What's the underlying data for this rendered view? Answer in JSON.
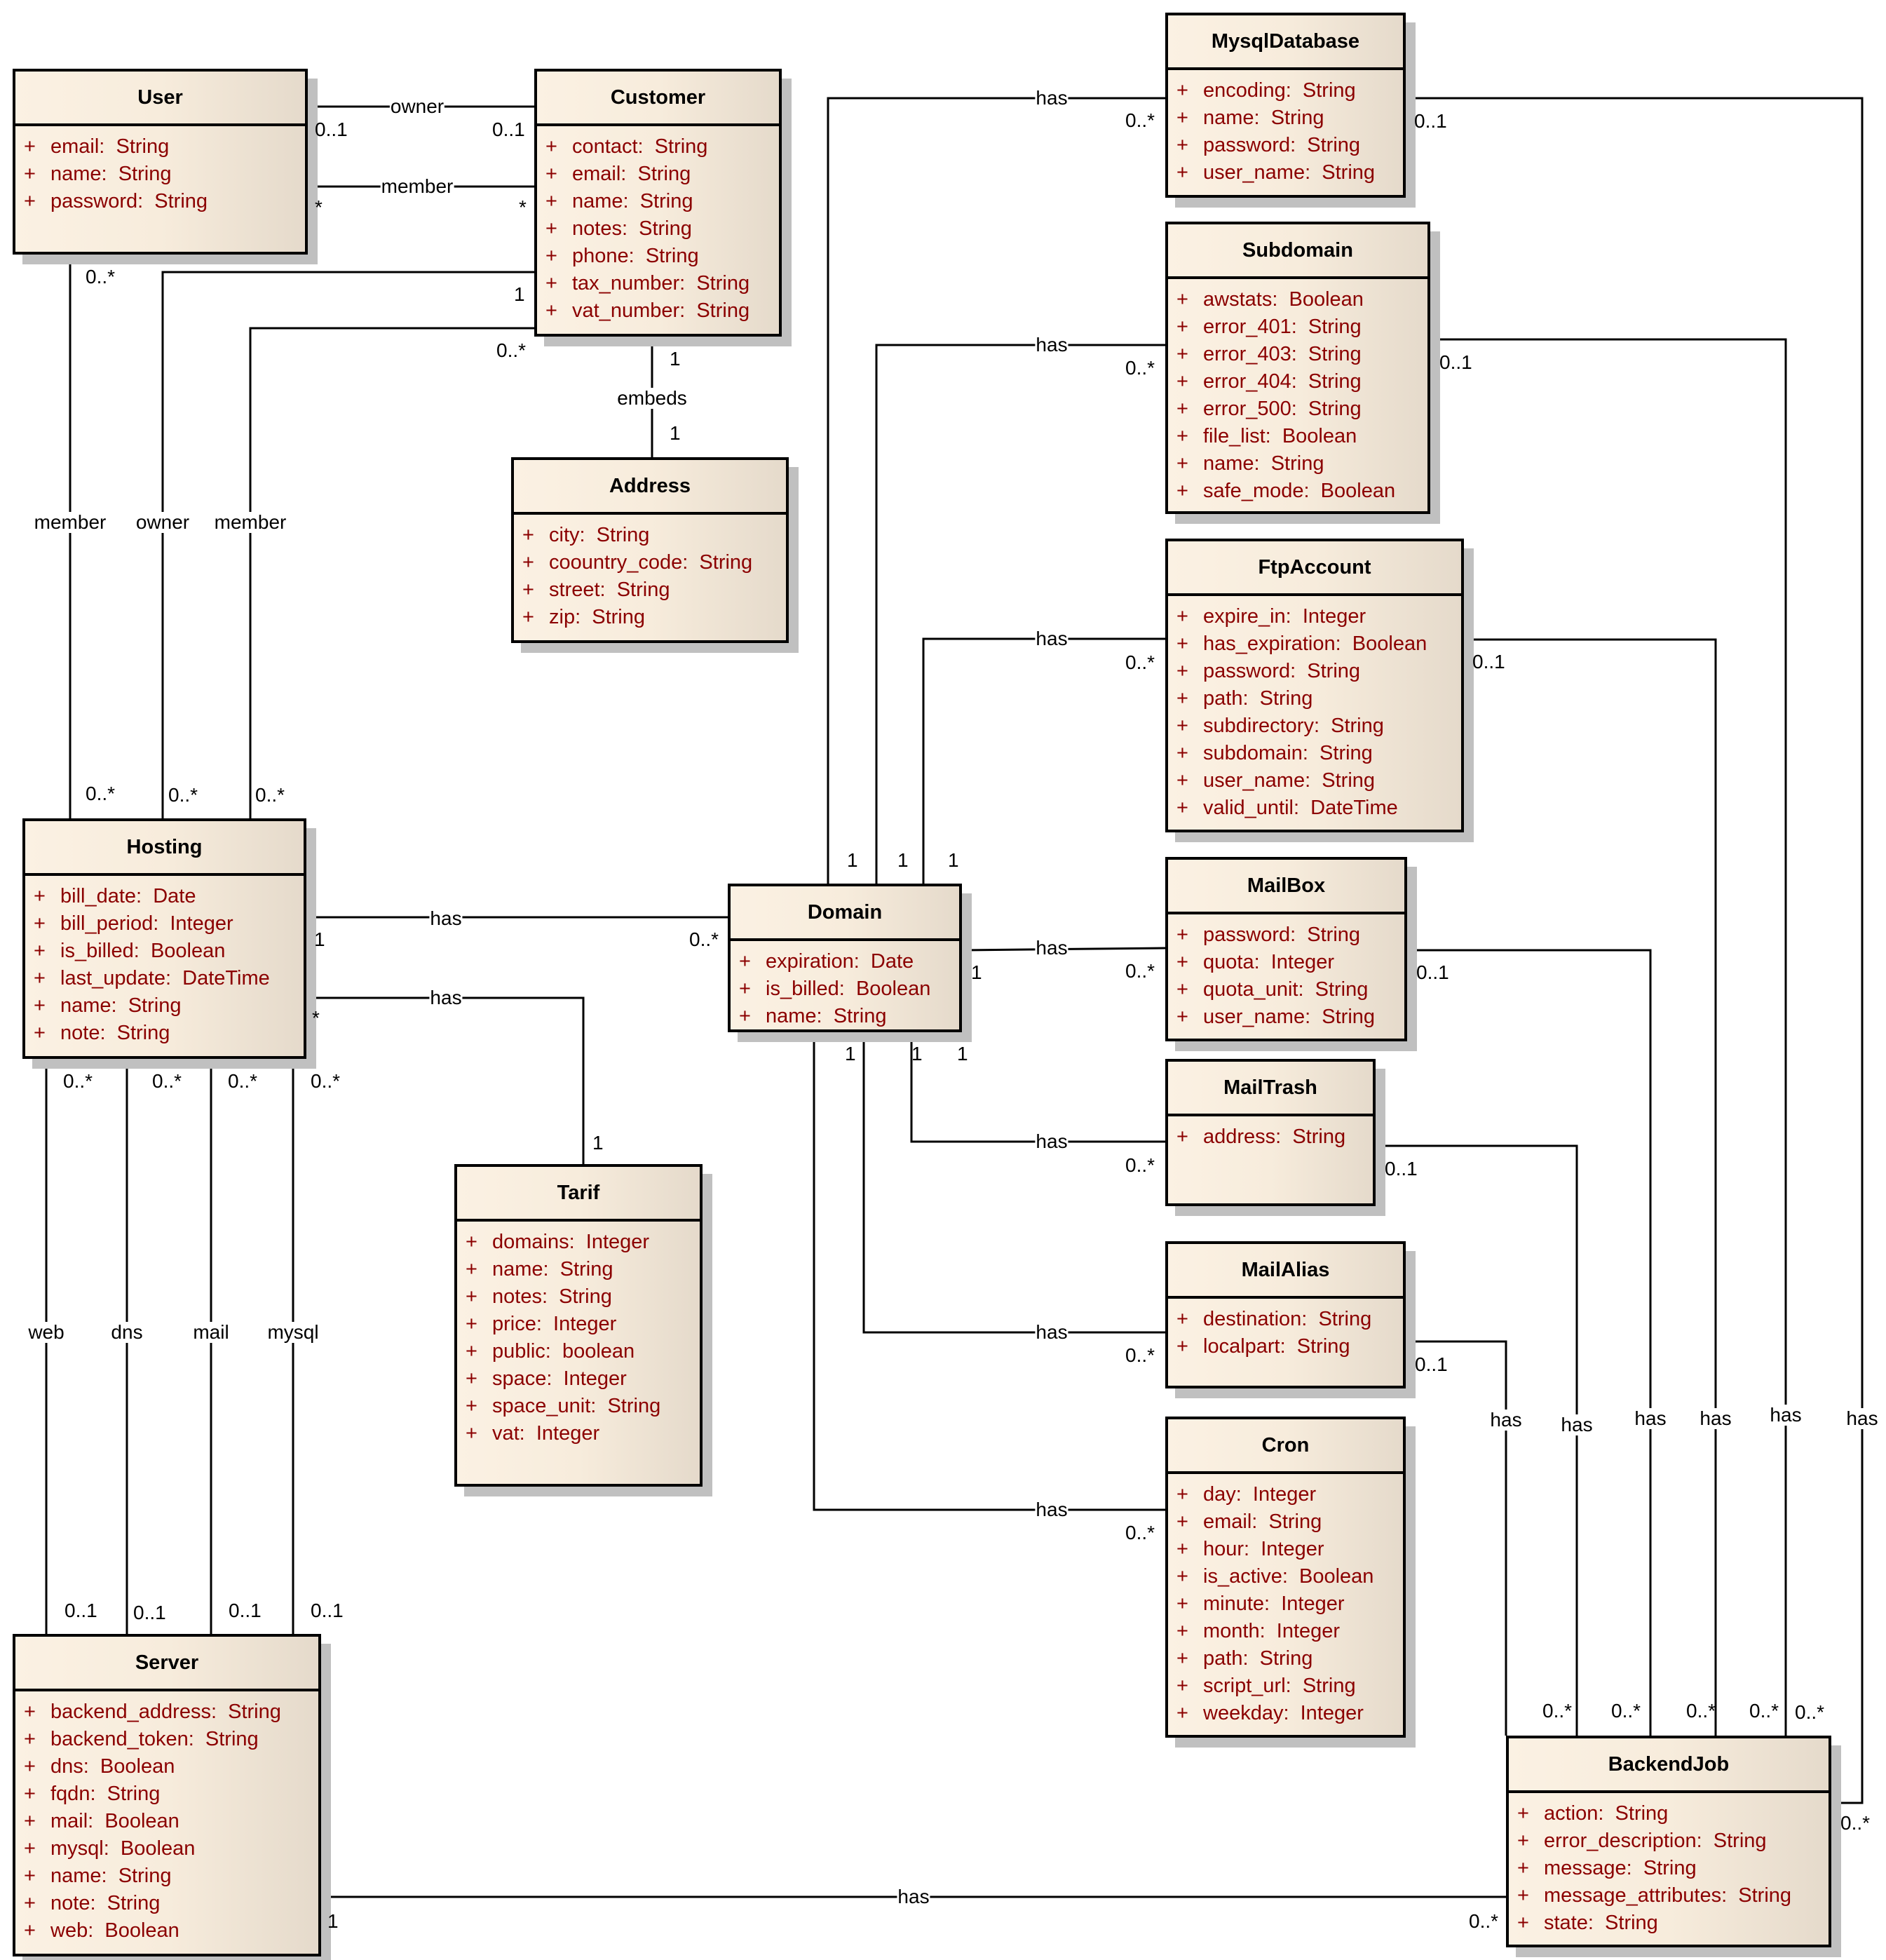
{
  "diagram": {
    "type": "UML class diagram",
    "classes": [
      {
        "id": "User",
        "name": "User",
        "attributes": [
          {
            "vis": "+",
            "text": "email:  String"
          },
          {
            "vis": "+",
            "text": "name:  String"
          },
          {
            "vis": "+",
            "text": "password:  String"
          }
        ]
      },
      {
        "id": "Customer",
        "name": "Customer",
        "attributes": [
          {
            "vis": "+",
            "text": "contact:  String"
          },
          {
            "vis": "+",
            "text": "email:  String"
          },
          {
            "vis": "+",
            "text": "name:  String"
          },
          {
            "vis": "+",
            "text": "notes:  String"
          },
          {
            "vis": "+",
            "text": "phone:  String"
          },
          {
            "vis": "+",
            "text": "tax_number:  String"
          },
          {
            "vis": "+",
            "text": "vat_number:  String"
          }
        ]
      },
      {
        "id": "MysqlDatabase",
        "name": "MysqlDatabase",
        "attributes": [
          {
            "vis": "+",
            "text": "encoding:  String"
          },
          {
            "vis": "+",
            "text": "name:  String"
          },
          {
            "vis": "+",
            "text": "password:  String"
          },
          {
            "vis": "+",
            "text": "user_name:  String"
          }
        ]
      },
      {
        "id": "Subdomain",
        "name": "Subdomain",
        "attributes": [
          {
            "vis": "+",
            "text": "awstats:  Boolean"
          },
          {
            "vis": "+",
            "text": "error_401:  String"
          },
          {
            "vis": "+",
            "text": "error_403:  String"
          },
          {
            "vis": "+",
            "text": "error_404:  String"
          },
          {
            "vis": "+",
            "text": "error_500:  String"
          },
          {
            "vis": "+",
            "text": "file_list:  Boolean"
          },
          {
            "vis": "+",
            "text": "name:  String"
          },
          {
            "vis": "+",
            "text": "safe_mode:  Boolean"
          }
        ]
      },
      {
        "id": "Address",
        "name": "Address",
        "attributes": [
          {
            "vis": "+",
            "text": "city:  String"
          },
          {
            "vis": "+",
            "text": "coountry_code:  String"
          },
          {
            "vis": "+",
            "text": "street:  String"
          },
          {
            "vis": "+",
            "text": "zip:  String"
          }
        ]
      },
      {
        "id": "FtpAccount",
        "name": "FtpAccount",
        "attributes": [
          {
            "vis": "+",
            "text": "expire_in:  Integer"
          },
          {
            "vis": "+",
            "text": "has_expiration:  Boolean"
          },
          {
            "vis": "+",
            "text": "password:  String"
          },
          {
            "vis": "+",
            "text": "path:  String"
          },
          {
            "vis": "+",
            "text": "subdirectory:  String"
          },
          {
            "vis": "+",
            "text": "subdomain:  String"
          },
          {
            "vis": "+",
            "text": "user_name:  String"
          },
          {
            "vis": "+",
            "text": "valid_until:  DateTime"
          }
        ]
      },
      {
        "id": "Hosting",
        "name": "Hosting",
        "attributes": [
          {
            "vis": "+",
            "text": "bill_date:  Date"
          },
          {
            "vis": "+",
            "text": "bill_period:  Integer"
          },
          {
            "vis": "+",
            "text": "is_billed:  Boolean"
          },
          {
            "vis": "+",
            "text": "last_update:  DateTime"
          },
          {
            "vis": "+",
            "text": "name:  String"
          },
          {
            "vis": "+",
            "text": "note:  String"
          }
        ]
      },
      {
        "id": "Domain",
        "name": "Domain",
        "attributes": [
          {
            "vis": "+",
            "text": "expiration:  Date"
          },
          {
            "vis": "+",
            "text": "is_billed:  Boolean"
          },
          {
            "vis": "+",
            "text": "name:  String"
          }
        ]
      },
      {
        "id": "MailBox",
        "name": "MailBox",
        "attributes": [
          {
            "vis": "+",
            "text": "password:  String"
          },
          {
            "vis": "+",
            "text": "quota:  Integer"
          },
          {
            "vis": "+",
            "text": "quota_unit:  String"
          },
          {
            "vis": "+",
            "text": "user_name:  String"
          }
        ]
      },
      {
        "id": "MailTrash",
        "name": "MailTrash",
        "attributes": [
          {
            "vis": "+",
            "text": "address:  String"
          }
        ]
      },
      {
        "id": "Tarif",
        "name": "Tarif",
        "attributes": [
          {
            "vis": "+",
            "text": "domains:  Integer"
          },
          {
            "vis": "+",
            "text": "name:  String"
          },
          {
            "vis": "+",
            "text": "notes:  String"
          },
          {
            "vis": "+",
            "text": "price:  Integer"
          },
          {
            "vis": "+",
            "text": "public:  boolean"
          },
          {
            "vis": "+",
            "text": "space:  Integer"
          },
          {
            "vis": "+",
            "text": "space_unit:  String"
          },
          {
            "vis": "+",
            "text": "vat:  Integer"
          }
        ]
      },
      {
        "id": "MailAlias",
        "name": "MailAlias",
        "attributes": [
          {
            "vis": "+",
            "text": "destination:  String"
          },
          {
            "vis": "+",
            "text": "localpart:  String"
          }
        ]
      },
      {
        "id": "Cron",
        "name": "Cron",
        "attributes": [
          {
            "vis": "+",
            "text": "day:  Integer"
          },
          {
            "vis": "+",
            "text": "email:  String"
          },
          {
            "vis": "+",
            "text": "hour:  Integer"
          },
          {
            "vis": "+",
            "text": "is_active:  Boolean"
          },
          {
            "vis": "+",
            "text": "minute:  Integer"
          },
          {
            "vis": "+",
            "text": "month:  Integer"
          },
          {
            "vis": "+",
            "text": "path:  String"
          },
          {
            "vis": "+",
            "text": "script_url:  String"
          },
          {
            "vis": "+",
            "text": "weekday:  Integer"
          }
        ]
      },
      {
        "id": "Server",
        "name": "Server",
        "attributes": [
          {
            "vis": "+",
            "text": "backend_address:  String"
          },
          {
            "vis": "+",
            "text": "backend_token:  String"
          },
          {
            "vis": "+",
            "text": "dns:  Boolean"
          },
          {
            "vis": "+",
            "text": "fqdn:  String"
          },
          {
            "vis": "+",
            "text": "mail:  Boolean"
          },
          {
            "vis": "+",
            "text": "mysql:  Boolean"
          },
          {
            "vis": "+",
            "text": "name:  String"
          },
          {
            "vis": "+",
            "text": "note:  String"
          },
          {
            "vis": "+",
            "text": "web:  Boolean"
          }
        ]
      },
      {
        "id": "BackendJob",
        "name": "BackendJob",
        "attributes": [
          {
            "vis": "+",
            "text": "action:  String"
          },
          {
            "vis": "+",
            "text": "error_description:  String"
          },
          {
            "vis": "+",
            "text": "message:  String"
          },
          {
            "vis": "+",
            "text": "message_attributes:  String"
          },
          {
            "vis": "+",
            "text": "state:  String"
          }
        ]
      }
    ],
    "associations": [
      {
        "id": "a1",
        "from": "User",
        "to": "Customer",
        "label": "owner",
        "from_mult": "0..1",
        "to_mult": "0..1"
      },
      {
        "id": "a2",
        "from": "User",
        "to": "Customer",
        "label": "member",
        "from_mult": "*",
        "to_mult": "*"
      },
      {
        "id": "a3",
        "from": "Customer",
        "to": "Address",
        "label": "embeds",
        "from_mult": "1",
        "to_mult": "1"
      },
      {
        "id": "a4",
        "from": "User",
        "to": "Hosting",
        "label": "member",
        "from_mult": "0..*",
        "to_mult": "0..*"
      },
      {
        "id": "a5",
        "from": "Customer",
        "to": "Hosting",
        "label": "owner",
        "from_mult": "1",
        "to_mult": "0..*"
      },
      {
        "id": "a6",
        "from": "Customer",
        "to": "Hosting",
        "label": "member",
        "from_mult": "0..*",
        "to_mult": "0..*"
      },
      {
        "id": "a7",
        "from": "Hosting",
        "to": "Domain",
        "label": "has",
        "from_mult": "1",
        "to_mult": "0..*"
      },
      {
        "id": "a8",
        "from": "Hosting",
        "to": "Tarif",
        "label": "has",
        "from_mult": "*",
        "to_mult": "1"
      },
      {
        "id": "a9",
        "from": "Hosting",
        "to": "Server",
        "label": "web",
        "from_mult": "0..*",
        "to_mult": "0..1"
      },
      {
        "id": "a10",
        "from": "Hosting",
        "to": "Server",
        "label": "dns",
        "from_mult": "0..*",
        "to_mult": "0..1"
      },
      {
        "id": "a11",
        "from": "Hosting",
        "to": "Server",
        "label": "mail",
        "from_mult": "0..*",
        "to_mult": "0..1"
      },
      {
        "id": "a12",
        "from": "Hosting",
        "to": "Server",
        "label": "mysql",
        "from_mult": "0..*",
        "to_mult": "0..1"
      },
      {
        "id": "a13",
        "from": "Domain",
        "to": "MysqlDatabase",
        "label": "has",
        "from_mult": "1",
        "to_mult": "0..*"
      },
      {
        "id": "a14",
        "from": "Domain",
        "to": "Subdomain",
        "label": "has",
        "from_mult": "1",
        "to_mult": "0..*"
      },
      {
        "id": "a15",
        "from": "Domain",
        "to": "FtpAccount",
        "label": "has",
        "from_mult": "1",
        "to_mult": "0..*"
      },
      {
        "id": "a16",
        "from": "Domain",
        "to": "MailBox",
        "label": "has",
        "from_mult": "1",
        "to_mult": "0..*"
      },
      {
        "id": "a17",
        "from": "Domain",
        "to": "MailTrash",
        "label": "has",
        "from_mult": "1",
        "to_mult": "0..*"
      },
      {
        "id": "a18",
        "from": "Domain",
        "to": "MailAlias",
        "label": "has",
        "from_mult": "1",
        "to_mult": "0..*"
      },
      {
        "id": "a19",
        "from": "Domain",
        "to": "Cron",
        "label": "has",
        "from_mult": "1",
        "to_mult": "0..*"
      },
      {
        "id": "a20",
        "from": "MailAlias",
        "to": "BackendJob",
        "label": "has",
        "from_mult": "0..1",
        "to_mult": "0..*"
      },
      {
        "id": "a21",
        "from": "MailTrash",
        "to": "BackendJob",
        "label": "has",
        "from_mult": "0..1",
        "to_mult": "0..*"
      },
      {
        "id": "a22",
        "from": "MailBox",
        "to": "BackendJob",
        "label": "has",
        "from_mult": "0..1",
        "to_mult": "0..*"
      },
      {
        "id": "a23",
        "from": "FtpAccount",
        "to": "BackendJob",
        "label": "has",
        "from_mult": "0..1",
        "to_mult": "0..*"
      },
      {
        "id": "a24",
        "from": "Subdomain",
        "to": "BackendJob",
        "label": "has",
        "from_mult": "0..1",
        "to_mult": "0..*"
      },
      {
        "id": "a25",
        "from": "MysqlDatabase",
        "to": "BackendJob",
        "label": "has",
        "from_mult": "0..1",
        "to_mult": "0..*"
      },
      {
        "id": "a26",
        "from": "Server",
        "to": "BackendJob",
        "label": "has",
        "from_mult": "1",
        "to_mult": "0..*"
      }
    ]
  }
}
